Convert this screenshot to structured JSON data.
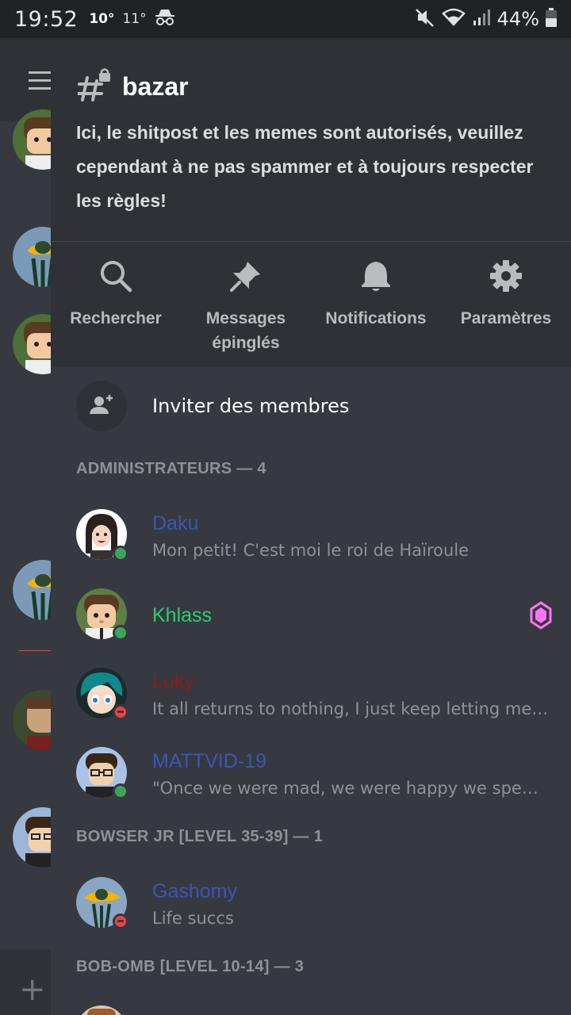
{
  "status_bar": {
    "time": "19:52",
    "temp_current": "10°",
    "temp_other": "11°",
    "battery": "44%"
  },
  "channel": {
    "name": "bazar",
    "topic": "Ici, le shitpost et les memes sont autorisés, veuillez cependant à ne pas spammer et à toujours respecter les règles!"
  },
  "actions": [
    {
      "label": "Rechercher",
      "icon": "search-icon"
    },
    {
      "label": "Messages épinglés",
      "icon": "pin-icon"
    },
    {
      "label": "Notifications",
      "icon": "bell-icon"
    },
    {
      "label": "Paramètres",
      "icon": "gear-icon"
    }
  ],
  "invite": {
    "label": "Inviter des membres",
    "icon": "add-user-icon"
  },
  "sections": [
    {
      "title": "ADMINISTRATEURS — 4"
    },
    {
      "title": "BOWSER JR [LEVEL 35-39] — 1"
    },
    {
      "title": "BOB-OMB [LEVEL 10-14] — 3"
    }
  ],
  "members": [
    {
      "name": "Daku",
      "status_text": "Mon petit! C'est moi le roi de Haïroule",
      "status": "online",
      "name_color": "#3b55b8"
    },
    {
      "name": "Khlass",
      "status_text": "",
      "status": "online",
      "name_color": "#2ecc71",
      "badge": "nitro-boost-icon"
    },
    {
      "name": "Luky",
      "status_text": "It all returns to nothing, I just keep letting me d...",
      "status": "dnd",
      "name_color": "#8b1c1c"
    },
    {
      "name": "MATTVID-19",
      "status_text": "\"Once we were mad, we were happy we spent a...",
      "status": "online",
      "name_color": "#3b55b8"
    },
    {
      "name": "Gashomy",
      "status_text": "Life succs",
      "status": "dnd",
      "name_color": "#3b55b8"
    }
  ],
  "colors": {
    "drawer_bg": "#36393f",
    "header_bg": "#2f3136",
    "online": "#3ba55c",
    "dnd": "#ed4245",
    "boost_badge": "#ff73fa"
  }
}
